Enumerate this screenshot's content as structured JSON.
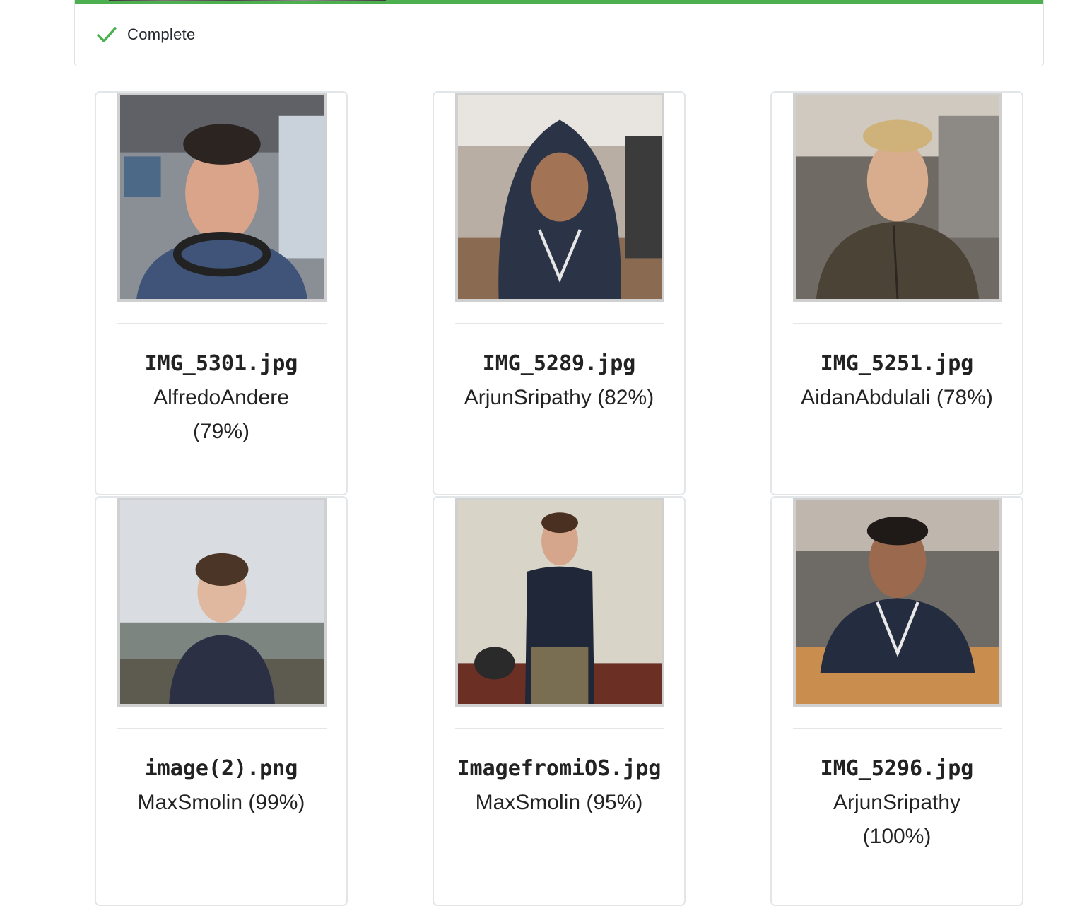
{
  "status": {
    "label": "Complete",
    "progress": 1.0,
    "icon": "check-icon",
    "accent_color": "#4caf50"
  },
  "results": [
    {
      "filename": "IMG_5301.jpg",
      "match": "AlfredoAndere (79%)"
    },
    {
      "filename": "IMG_5289.jpg",
      "match": "ArjunSripathy (82%)"
    },
    {
      "filename": "IMG_5251.jpg",
      "match": "AidanAbdulali (78%)"
    },
    {
      "filename": "image(2).png",
      "match": "MaxSmolin (99%)"
    },
    {
      "filename": "ImagefromiOS.jpg",
      "match": "MaxSmolin (95%)"
    },
    {
      "filename": "IMG_5296.jpg",
      "match": "ArjunSripathy (100%)"
    }
  ]
}
